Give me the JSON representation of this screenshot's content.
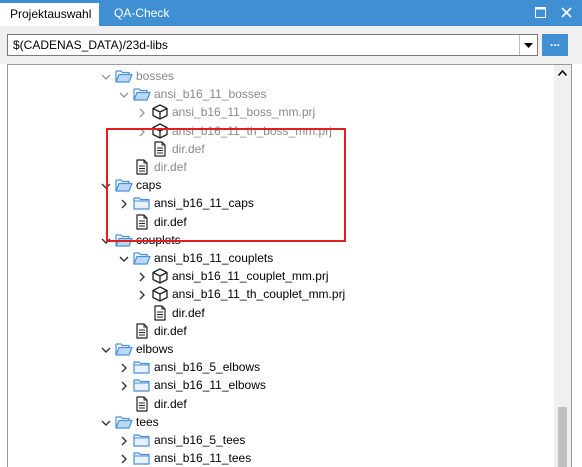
{
  "tabs": [
    {
      "label": "Projektauswahl",
      "active": true
    },
    {
      "label": "QA-Check",
      "active": false
    }
  ],
  "window_buttons": [
    "maximize-icon",
    "close-icon"
  ],
  "path": {
    "value": "$(CADENAS_DATA)/23d-libs",
    "browse_label": "..."
  },
  "colors": {
    "accent": "#3f8fd2",
    "highlight": "#e02020",
    "greyed_text": "#888888",
    "folder": "#4a90d9"
  },
  "tree": [
    {
      "label": "bosses",
      "depth": 0,
      "type": "folder-open",
      "expander": "expanded",
      "greyed": true
    },
    {
      "label": "ansi_b16_11_bosses",
      "depth": 1,
      "type": "folder-open",
      "expander": "expanded",
      "greyed": true
    },
    {
      "label": "ansi_b16_11_boss_mm.prj",
      "depth": 2,
      "type": "project",
      "expander": "collapsed",
      "greyed": true
    },
    {
      "label": "ansi_b16_11_th_boss_mm.prj",
      "depth": 2,
      "type": "project",
      "expander": "collapsed",
      "greyed": true
    },
    {
      "label": "dir.def",
      "depth": 2,
      "type": "file",
      "expander": "none",
      "greyed": true
    },
    {
      "label": "dir.def",
      "depth": 1,
      "type": "file",
      "expander": "none",
      "greyed": true
    },
    {
      "label": "caps",
      "depth": 0,
      "type": "folder-open",
      "expander": "expanded",
      "greyed": false
    },
    {
      "label": "ansi_b16_11_caps",
      "depth": 1,
      "type": "folder",
      "expander": "collapsed",
      "greyed": false
    },
    {
      "label": "dir.def",
      "depth": 1,
      "type": "file",
      "expander": "none",
      "greyed": false
    },
    {
      "label": "couplets",
      "depth": 0,
      "type": "folder-open",
      "expander": "expanded",
      "greyed": false
    },
    {
      "label": "ansi_b16_11_couplets",
      "depth": 1,
      "type": "folder-open",
      "expander": "expanded",
      "greyed": false
    },
    {
      "label": "ansi_b16_11_couplet_mm.prj",
      "depth": 2,
      "type": "project",
      "expander": "collapsed",
      "greyed": false
    },
    {
      "label": "ansi_b16_11_th_couplet_mm.prj",
      "depth": 2,
      "type": "project",
      "expander": "collapsed",
      "greyed": false
    },
    {
      "label": "dir.def",
      "depth": 2,
      "type": "file",
      "expander": "none",
      "greyed": false
    },
    {
      "label": "dir.def",
      "depth": 1,
      "type": "file",
      "expander": "none",
      "greyed": false
    },
    {
      "label": "elbows",
      "depth": 0,
      "type": "folder-open",
      "expander": "expanded",
      "greyed": false
    },
    {
      "label": "ansi_b16_5_elbows",
      "depth": 1,
      "type": "folder",
      "expander": "collapsed",
      "greyed": false
    },
    {
      "label": "ansi_b16_11_elbows",
      "depth": 1,
      "type": "folder",
      "expander": "collapsed",
      "greyed": false
    },
    {
      "label": "dir.def",
      "depth": 1,
      "type": "file",
      "expander": "none",
      "greyed": false
    },
    {
      "label": "tees",
      "depth": 0,
      "type": "folder-open",
      "expander": "expanded",
      "greyed": false
    },
    {
      "label": "ansi_b16_5_tees",
      "depth": 1,
      "type": "folder",
      "expander": "collapsed",
      "greyed": false
    },
    {
      "label": "ansi_b16_11_tees",
      "depth": 1,
      "type": "folder",
      "expander": "collapsed",
      "greyed": false
    }
  ]
}
